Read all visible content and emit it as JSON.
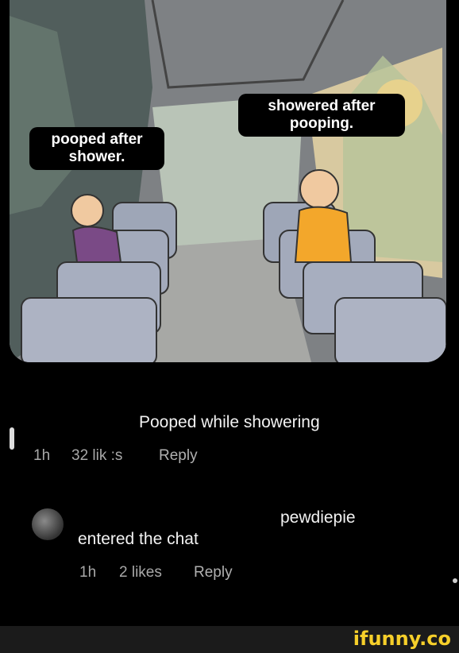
{
  "meme": {
    "left_caption": "pooped after shower.",
    "right_caption": "showered after pooping."
  },
  "comments": [
    {
      "text": "Pooped while showering",
      "time": "1h",
      "likes": "32 lik :s",
      "reply": "Reply"
    },
    {
      "text_line1": "pewdiepie",
      "text_line2": "entered the chat",
      "time": "1h",
      "likes": "2 likes",
      "reply": "Reply"
    }
  ],
  "watermark": "ifunny.co"
}
